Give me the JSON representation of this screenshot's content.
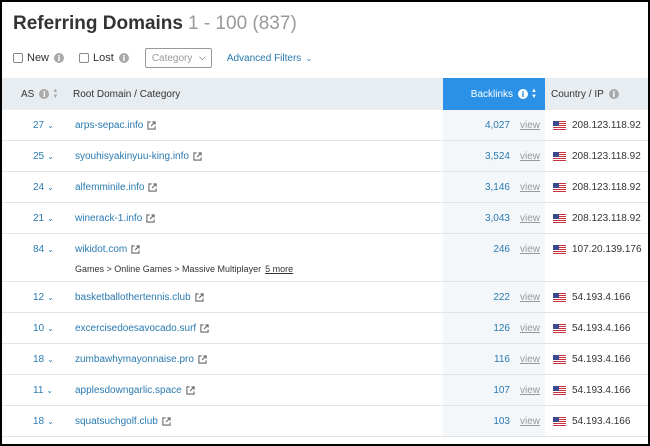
{
  "header": {
    "title": "Referring Domains",
    "range": "1 - 100 (837)"
  },
  "filters": {
    "new_label": "New",
    "lost_label": "Lost",
    "category_placeholder": "Category",
    "advanced_label": "Advanced Filters"
  },
  "columns": {
    "as": "AS",
    "domain": "Root Domain / Category",
    "backlinks": "Backlinks",
    "country": "Country / IP"
  },
  "rows": [
    {
      "as": "27",
      "domain": "arps-sepac.info",
      "backlinks": "4,027",
      "view": "view",
      "ip": "208.123.118.92"
    },
    {
      "as": "25",
      "domain": "syouhisyakinyuu-king.info",
      "backlinks": "3,524",
      "view": "view",
      "ip": "208.123.118.92"
    },
    {
      "as": "24",
      "domain": "alfemminile.info",
      "backlinks": "3,146",
      "view": "view",
      "ip": "208.123.118.92"
    },
    {
      "as": "21",
      "domain": "winerack-1.info",
      "backlinks": "3,043",
      "view": "view",
      "ip": "208.123.118.92"
    },
    {
      "as": "84",
      "domain": "wikidot.com",
      "backlinks": "246",
      "view": "view",
      "ip": "107.20.139.176",
      "category": "Games > Online Games > Massive Multiplayer",
      "more": "5 more"
    },
    {
      "as": "12",
      "domain": "basketballothertennis.club",
      "backlinks": "222",
      "view": "view",
      "ip": "54.193.4.166"
    },
    {
      "as": "10",
      "domain": "excercisedoesavocado.surf",
      "backlinks": "126",
      "view": "view",
      "ip": "54.193.4.166"
    },
    {
      "as": "18",
      "domain": "zumbawhymayonnaise.pro",
      "backlinks": "116",
      "view": "view",
      "ip": "54.193.4.166"
    },
    {
      "as": "11",
      "domain": "applesdowngarlic.space",
      "backlinks": "107",
      "view": "view",
      "ip": "54.193.4.166"
    },
    {
      "as": "18",
      "domain": "squatsuchgolf.club",
      "backlinks": "103",
      "view": "view",
      "ip": "54.193.4.166"
    }
  ],
  "icons": {
    "info": "info-icon",
    "external": "external-link-icon",
    "flag": "us-flag-icon",
    "chevron": "chevron-down-icon",
    "sort": "sort-icon"
  },
  "colors": {
    "link": "#2a7ab0",
    "accent": "#2b91e6",
    "header_bg": "#e8edf2"
  }
}
